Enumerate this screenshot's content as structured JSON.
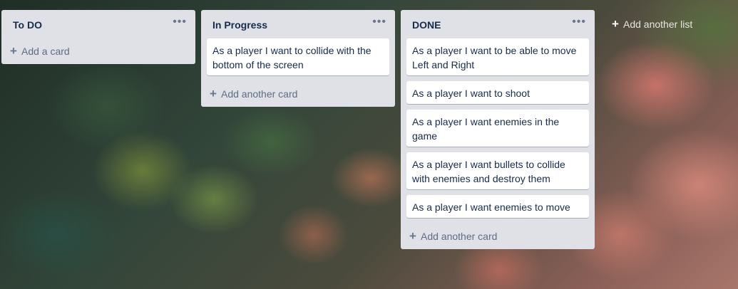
{
  "lists": [
    {
      "title": "To DO",
      "menu_icon": "ellipsis-icon",
      "cards": [],
      "add_label": "Add a card"
    },
    {
      "title": "In Progress",
      "menu_icon": "ellipsis-icon",
      "cards": [
        "As a player I want to collide with the bottom of the screen"
      ],
      "add_label": "Add another card"
    },
    {
      "title": "DONE",
      "menu_icon": "ellipsis-icon",
      "cards": [
        "As a player I want to be able to move Left and Right",
        "As a player I want to shoot",
        "As a player I want enemies in the game",
        "As a player I want bullets to collide with enemies and destroy them",
        "As a player I want enemies to move"
      ],
      "add_label": "Add another card"
    }
  ],
  "add_list_label": "Add another list",
  "icons": {
    "menu": "•••",
    "plus": "+"
  },
  "colors": {
    "list_bg": "#dfe1e6",
    "card_bg": "#ffffff",
    "title_text": "#172b4d",
    "muted_text": "#5e6c84"
  }
}
